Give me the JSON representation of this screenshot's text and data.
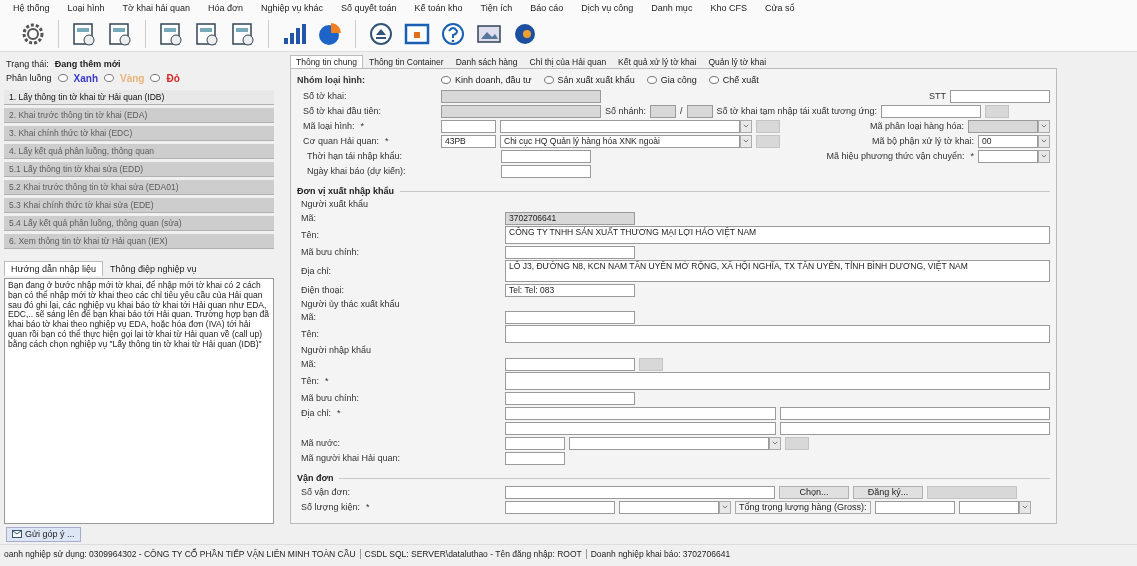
{
  "menu": [
    "Hệ thống",
    "Loại hình",
    "Tờ khai hải quan",
    "Hóa đơn",
    "Nghiệp vụ khác",
    "Số quyết toán",
    "Kế toán kho",
    "Tiện ích",
    "Báo cáo",
    "Dịch vụ công",
    "Danh mục",
    "Kho CFS",
    "Cửa sổ"
  ],
  "left": {
    "status_label": "Trạng thái:",
    "status_value": "Đang thêm mới",
    "channel_label": "Phân luồng",
    "channels": [
      {
        "label": "Xanh",
        "color": "#3a3ac8",
        "selected": false
      },
      {
        "label": "Vàng",
        "color": "#e6b47a",
        "selected": false
      },
      {
        "label": "Đỏ",
        "color": "#d42828",
        "selected": false
      }
    ],
    "steps": [
      {
        "label": "1. Lấy thông tin tờ khai từ Hải quan (IDB)",
        "disabled": false
      },
      {
        "label": "2. Khai trước thông tin tờ khai (EDA)",
        "disabled": true
      },
      {
        "label": "3. Khai chính thức tờ khai (EDC)",
        "disabled": true
      },
      {
        "label": "4. Lấy kết quả phân luồng, thông quan",
        "disabled": true
      },
      {
        "label": "5.1 Lấy thông tin tờ khai sửa (EDD)",
        "disabled": true
      },
      {
        "label": "5.2 Khai trước thông tin tờ khai sửa (EDA01)",
        "disabled": true
      },
      {
        "label": "5.3 Khai chính thức tờ khai sửa (EDE)",
        "disabled": true
      },
      {
        "label": "5.4 Lấy kết quả phân luồng, thông quan (sửa)",
        "disabled": true
      },
      {
        "label": "6. Xem thông tin tờ khai từ Hải quan (IEX)",
        "disabled": true
      }
    ],
    "guide_tabs": [
      {
        "label": "Hướng dẫn nhập liệu",
        "selected": true
      },
      {
        "label": "Thông điệp nghiệp vụ",
        "selected": false
      }
    ],
    "guide_text": "Bạn đang ở bước nhập mới tờ khai, để nhập mới tờ khai có 2 cách bạn có thể nhập mới tờ khai theo các chỉ tiêu yêu cầu của Hải quan sau đó ghi lại, các nghiệp vụ khai báo tờ khai tới Hải quan như EDA, EDC,.. sẽ sáng lên để bạn khai báo tới Hải quan. Trường hợp bạn đã khai báo tờ khai theo nghiệp vụ EDA, hoặc hóa đơn (IVA) tới hải quan rồi bạn có thể thực hiện gọi lại tờ khai từ Hải quan về (call up) bằng cách chọn nghiệp vụ \"Lấy thông tin tờ khai từ Hải quan (IDB)\""
  },
  "form_tabs": [
    {
      "label": "Thông tin chung",
      "selected": true
    },
    {
      "label": "Thông tin Container",
      "selected": false
    },
    {
      "label": "Danh sách hàng",
      "selected": false
    },
    {
      "label": "Chỉ thị của Hải quan",
      "selected": false
    },
    {
      "label": "Kết quả xử lý tờ khai",
      "selected": false
    },
    {
      "label": "Quản lý tờ khai",
      "selected": false
    }
  ],
  "general": {
    "group_label": "Nhóm loại hình:",
    "group_options": [
      {
        "label": "Kinh doanh, đầu tư",
        "selected": false
      },
      {
        "label": "Sản xuất xuất khẩu",
        "selected": false
      },
      {
        "label": "Gia công",
        "selected": false
      },
      {
        "label": "Chế xuất",
        "selected": false
      }
    ],
    "declaration_no_label": "Số tờ khai:",
    "stt_label": "STT",
    "first_no_label": "Số tờ khai đầu tiên:",
    "branch_label": "Số nhánh:",
    "branch_separator": "/",
    "temp_import_label": "Số tờ khai tạm nhập tái xuất tương ứng:",
    "type_code_label": "Mã loại hình:",
    "type_code_mark": "*",
    "goods_class_label": "Mã phân loại hàng hóa:",
    "office_label": "Cơ quan Hải quan:",
    "office_mark": "*",
    "office_code": "43PB",
    "office_name": "Chi cục HQ Quản lý hàng hóa XNK ngoài",
    "unit_label": "Mã bộ phận xử lý tờ khai:",
    "unit_value": "00",
    "reimport_label": "Thời hạn tái nhập khẩu:",
    "transport_label": "Mã hiệu phương thức vận chuyển:",
    "transport_mark": "*",
    "expected_date_label": "Ngày khai báo (dự kiến):"
  },
  "parties": {
    "title": "Đơn vị xuất nhập khẩu",
    "exporter": {
      "title": "Người xuất khẩu",
      "code_label": "Mã:",
      "code": "3702706641",
      "name_label": "Tên:",
      "name": "CÔNG TY TNHH SẢN XUẤT THƯƠNG MẠI LỢI HẢO VIỆT NAM",
      "postal_label": "Mã bưu chính:",
      "address_label": "Địa chỉ:",
      "address": "LÔ J3, ĐƯỜNG N8, KCN NAM TÂN UYÊN MỞ RỘNG, XÃ HỘI NGHĨA, TX TÂN UYÊN, TỈNH BÌNH DƯƠNG, VIỆT NAM",
      "phone_label": "Điện thoại:",
      "phone": "Tel: Tel: 083"
    },
    "entrusted": {
      "title": "Người ủy thác xuất khẩu",
      "code_label": "Mã:",
      "name_label": "Tên:"
    },
    "importer": {
      "title": "Người nhập khẩu",
      "code_label": "Mã:",
      "name_label": "Tên:",
      "name_mark": "*",
      "postal_label": "Mã bưu chính:",
      "address_label": "Địa chỉ:",
      "address_mark": "*",
      "country_label": "Mã nước:"
    },
    "agent_label": "Mã người khai Hải quan:"
  },
  "bill": {
    "title": "Vận đơn",
    "bill_no_label": "Số vận đơn:",
    "buttons": [
      "Chọn...",
      "Đăng ký..."
    ],
    "qty_label": "Số lượng kiện:",
    "qty_mark": "*",
    "gross_label": "Tổng trọng lượng hàng (Gross):"
  },
  "feedback_button": "Gửi góp ý ...",
  "status_bar": [
    "oanh nghiệp sử dụng: 0309964302 - CÔNG TY CỔ PHẦN TIẾP VẬN LIÊN MINH TOÀN CẦU",
    "CSDL SQL: SERVER\\dataluthao - Tên đăng nhập: ROOT",
    "Doanh nghiệp khai báo: 3702706641"
  ]
}
